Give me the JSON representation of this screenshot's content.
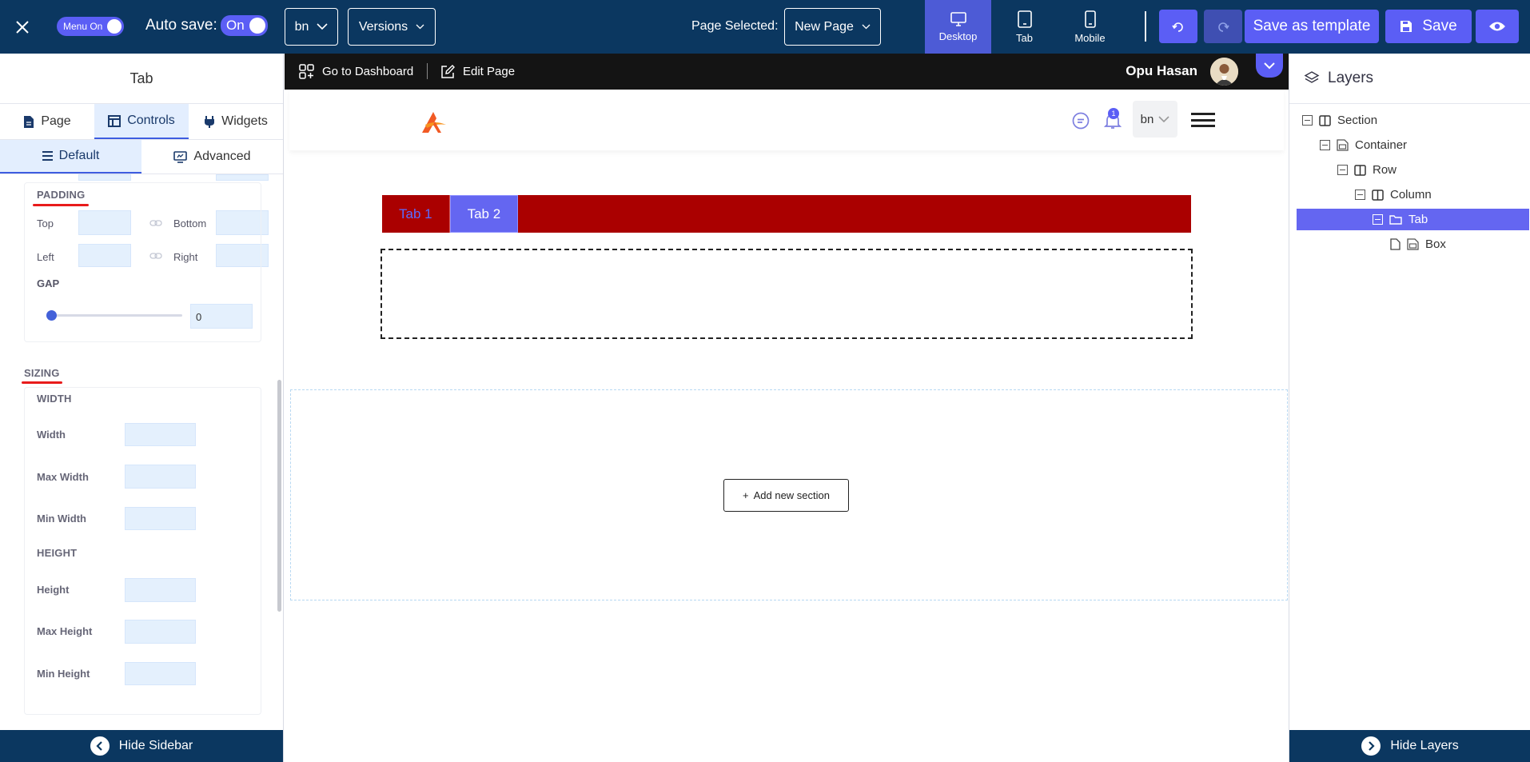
{
  "toolbar": {
    "menu_toggle_label": "Menu On",
    "autosave_label": "Auto save:",
    "autosave_value": "On",
    "lang": "bn",
    "versions_label": "Versions",
    "page_selected_label": "Page Selected:",
    "page_selected_value": "New Page",
    "devices": [
      {
        "label": "Desktop",
        "icon": "desktop-icon",
        "active": true
      },
      {
        "label": "Tab",
        "icon": "tablet-icon",
        "active": false
      },
      {
        "label": "Mobile",
        "icon": "mobile-icon",
        "active": false
      }
    ],
    "save_template_label": "Save as template",
    "save_label": "Save",
    "colors": {
      "toolbar_bg": "#0b3760",
      "accent": "#5b5ef5",
      "active_device": "#4d5bd6"
    }
  },
  "sidebar": {
    "title": "Tab",
    "tabs": [
      {
        "label": "Page",
        "icon": "page-icon"
      },
      {
        "label": "Controls",
        "icon": "layout-icon",
        "active": true
      },
      {
        "label": "Widgets",
        "icon": "plug-icon"
      }
    ],
    "subtabs": [
      {
        "label": "Default",
        "icon": "list-icon",
        "active": true
      },
      {
        "label": "Advanced",
        "icon": "advanced-icon"
      }
    ],
    "padding": {
      "heading": "PADDING",
      "top_label": "Top",
      "bottom_label": "Bottom",
      "left_label": "Left",
      "right_label": "Right"
    },
    "gap": {
      "heading": "GAP",
      "value": "0"
    },
    "sizing": {
      "heading": "SIZING",
      "width_heading": "WIDTH",
      "width_label": "Width",
      "max_width_label": "Max Width",
      "min_width_label": "Min Width",
      "height_heading": "HEIGHT",
      "height_label": "Height",
      "max_height_label": "Max Height",
      "min_height_label": "Min Height"
    },
    "hide_label": "Hide Sidebar"
  },
  "canvas": {
    "nav": {
      "dashboard_label": "Go to Dashboard",
      "edit_label": "Edit Page",
      "user_name": "Opu Hasan"
    },
    "header": {
      "notification_count": "1",
      "lang": "bn"
    },
    "tabs": [
      {
        "label": "Tab 1"
      },
      {
        "label": "Tab 2"
      }
    ],
    "add_section_label": "Add new section",
    "colors": {
      "tab_strip": "#aa0000",
      "tab_active": "#6466f1"
    }
  },
  "layers": {
    "title": "Layers",
    "tree": [
      {
        "label": "Section",
        "icon": "columns-icon"
      },
      {
        "label": "Container",
        "icon": "container-icon"
      },
      {
        "label": "Row",
        "icon": "columns-icon"
      },
      {
        "label": "Column",
        "icon": "columns-icon"
      },
      {
        "label": "Tab",
        "icon": "folder-icon",
        "selected": true
      },
      {
        "label": "Box",
        "icon": "box-icon"
      }
    ],
    "hide_label": "Hide Layers"
  }
}
